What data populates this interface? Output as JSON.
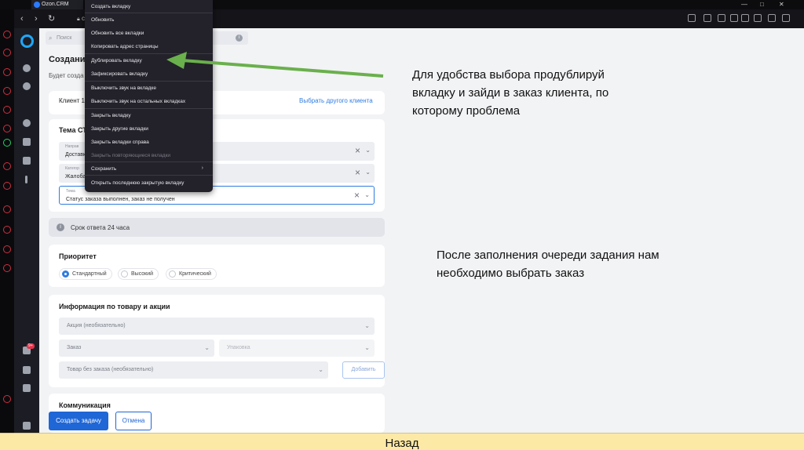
{
  "browser": {
    "tab_title": "Ozon.CRM",
    "url_fragment": "cr",
    "win_min": "—",
    "win_max": "□",
    "win_close": "✕"
  },
  "app": {
    "search_placeholder": "Поиск",
    "page_title": "Создание",
    "page_subtitle": "Будет созда",
    "badge": "9+"
  },
  "client": {
    "label": "Клиент 1",
    "link": "Выбрать другого клиента"
  },
  "topic_card": {
    "heading": "Тема СТ",
    "fields": [
      {
        "caption": "Направ",
        "value": "Доставк"
      },
      {
        "caption": "Категор",
        "value": "Жалоба"
      },
      {
        "caption": "Тема",
        "value": "Статус заказа выполнен, заказ не получен"
      }
    ]
  },
  "notice": {
    "text": "Срок ответа 24 часа"
  },
  "priority": {
    "heading": "Приоритет",
    "options": [
      "Стандартный",
      "Высокий",
      "Критический"
    ]
  },
  "product": {
    "heading": "Информация по товару и акции",
    "promo": "Акция (необязательно)",
    "order": "Заказ",
    "package": "Упаковка",
    "no_order": "Товар без заказа (необязательно)",
    "add": "Добавить"
  },
  "communication": {
    "heading": "Коммуникация"
  },
  "actions": {
    "create": "Создать задачу",
    "cancel": "Отмена"
  },
  "context_menu": {
    "items": [
      {
        "label": "Создать вкладку"
      },
      {
        "label": "Обновить"
      },
      {
        "label": "Обновить все вкладки"
      },
      {
        "label": "Копировать адрес страницы"
      },
      {
        "label": "Дублировать вкладку"
      },
      {
        "label": "Зафиксировать вкладку"
      },
      {
        "label": "Выключить звук на вкладке"
      },
      {
        "label": "Выключить звук на остальных вкладках"
      },
      {
        "label": "Закрыть вкладку"
      },
      {
        "label": "Закрыть другие вкладки"
      },
      {
        "label": "Закрыть вкладки справа"
      },
      {
        "label": "Закрыть повторяющиеся вкладки"
      },
      {
        "label": "Сохранить"
      },
      {
        "label": "Открыть последнюю закрытую вкладку"
      }
    ],
    "submenu_arrow": "›"
  },
  "annotations": {
    "note1": [
      "Для удобства выбора продублируй",
      "вкладку и зайди в заказ клиента, по",
      "которому проблема"
    ],
    "note2": [
      "После заполнения очереди задания нам",
      "необходимо выбрать заказ"
    ],
    "back": "Назад",
    "arrow_color": "#6ab04c"
  },
  "colors": {
    "accent": "#1f66d6",
    "menu_bg": "#23212a",
    "footer_bg": "#fde9a6"
  }
}
